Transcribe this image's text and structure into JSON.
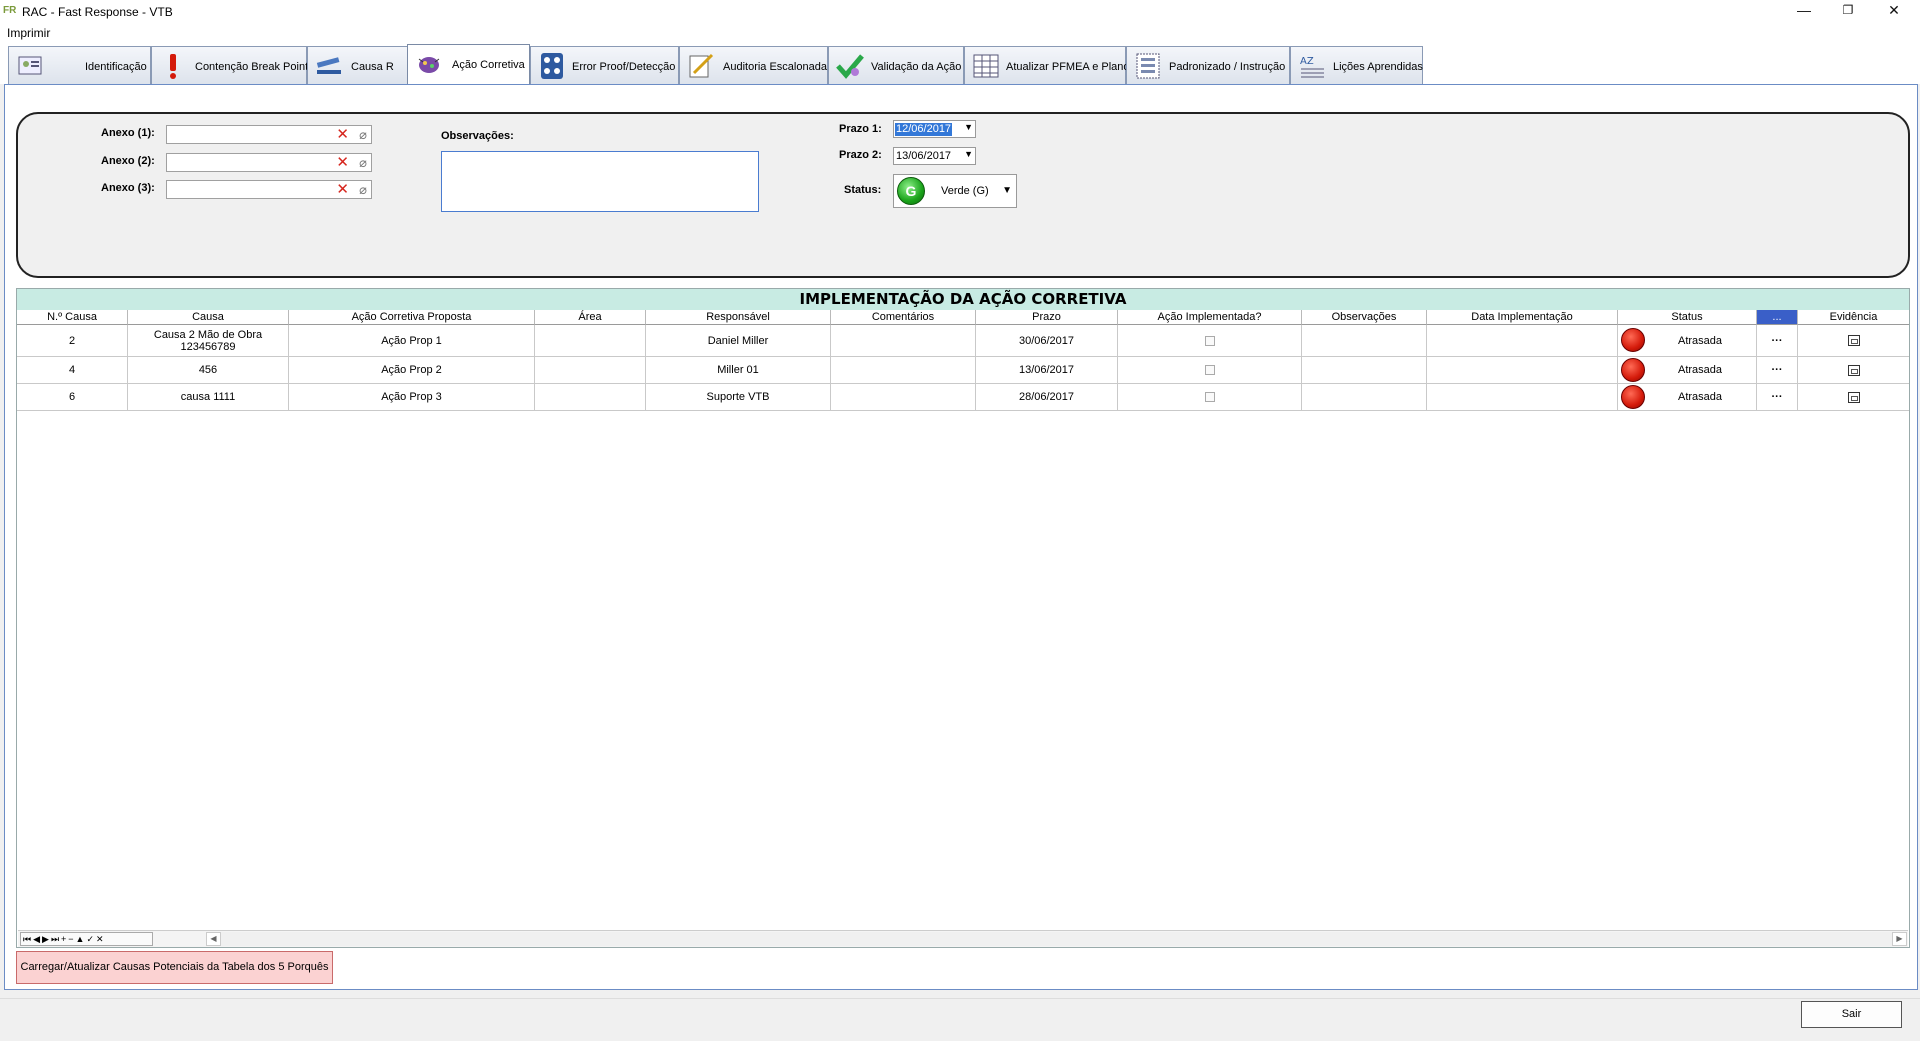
{
  "window": {
    "title": "RAC - Fast Response - VTB",
    "app_icon": "FR",
    "minimize": "—",
    "restore": "❐",
    "close": "✕"
  },
  "menu": {
    "print_label": "Imprimir"
  },
  "tabs": [
    {
      "label": "Identificação",
      "icon": "id-card-icon"
    },
    {
      "label": "Contenção Break Point",
      "icon": "exclamation-icon"
    },
    {
      "label": "Causa R",
      "icon": "stapler-icon"
    },
    {
      "label": "Ação Corretiva",
      "icon": "bug-icon",
      "active": true
    },
    {
      "label": "Error Proof/Detecção",
      "icon": "traffic-light-icon"
    },
    {
      "label": "Auditoria Escalonada",
      "icon": "pencil-sheet-icon"
    },
    {
      "label": "Validação da Ação",
      "icon": "checkmark-icon"
    },
    {
      "label": "Atualizar PFMEA e Plano",
      "icon": "spreadsheet-icon"
    },
    {
      "label": "Padronizado / Instrução",
      "icon": "list-icon"
    },
    {
      "label": "Lições Aprendidas",
      "icon": "abc-list-icon"
    }
  ],
  "form": {
    "anexo1_label": "Anexo (1):",
    "anexo2_label": "Anexo (2):",
    "anexo3_label": "Anexo (3):",
    "anexo1_value": "",
    "anexo2_value": "",
    "anexo3_value": "",
    "observacoes_label": "Observações:",
    "observacoes_value": "",
    "prazo1_label": "Prazo 1:",
    "prazo1_value": "12/06/2017",
    "prazo2_label": "Prazo 2:",
    "prazo2_value": "13/06/2017",
    "status_label": "Status:",
    "status_letter": "G",
    "status_value": "Verde (G)",
    "status_color": "#1aa31a"
  },
  "grid": {
    "title": "IMPLEMENTAÇÃO DA AÇÃO CORRETIVA",
    "title_bg": "#c8ebe3",
    "columns": [
      "N.º Causa",
      "Causa",
      "Ação Corretiva Proposta",
      "Área",
      "Responsável",
      "Comentários",
      "Prazo",
      "Ação Implementada?",
      "Observações",
      "Data Implementação",
      "Status",
      "...",
      "Evidência"
    ],
    "rows": [
      {
        "n_causa": "2",
        "causa_l1": "Causa 2 Mão de Obra",
        "causa_l2": "123456789",
        "acao": "Ação Prop 1",
        "area": "",
        "responsavel": "Daniel Miller",
        "comentarios": "",
        "prazo": "30/06/2017",
        "implementada": false,
        "observacoes": "",
        "data_impl": "",
        "status": "Atrasada",
        "status_color": "#d41a0a",
        "more": "···"
      },
      {
        "n_causa": "4",
        "causa_l1": "456",
        "causa_l2": "",
        "acao": "Ação Prop 2",
        "area": "",
        "responsavel": "Miller 01",
        "comentarios": "",
        "prazo": "13/06/2017",
        "implementada": false,
        "observacoes": "",
        "data_impl": "",
        "status": "Atrasada",
        "status_color": "#d41a0a",
        "more": "···"
      },
      {
        "n_causa": "6",
        "causa_l1": "causa 1111",
        "causa_l2": "",
        "acao": "Ação Prop 3",
        "area": "",
        "responsavel": "Suporte VTB",
        "comentarios": "",
        "prazo": "28/06/2017",
        "implementada": false,
        "observacoes": "",
        "data_impl": "",
        "status": "Atrasada",
        "status_color": "#d41a0a",
        "more": "···"
      }
    ],
    "nav_glyphs": "⏮◀▶⏭+−▲✓✕"
  },
  "buttons": {
    "load_label": "Carregar/Atualizar Causas Potenciais da Tabela dos 5 Porquês",
    "exit_label": "Sair"
  }
}
